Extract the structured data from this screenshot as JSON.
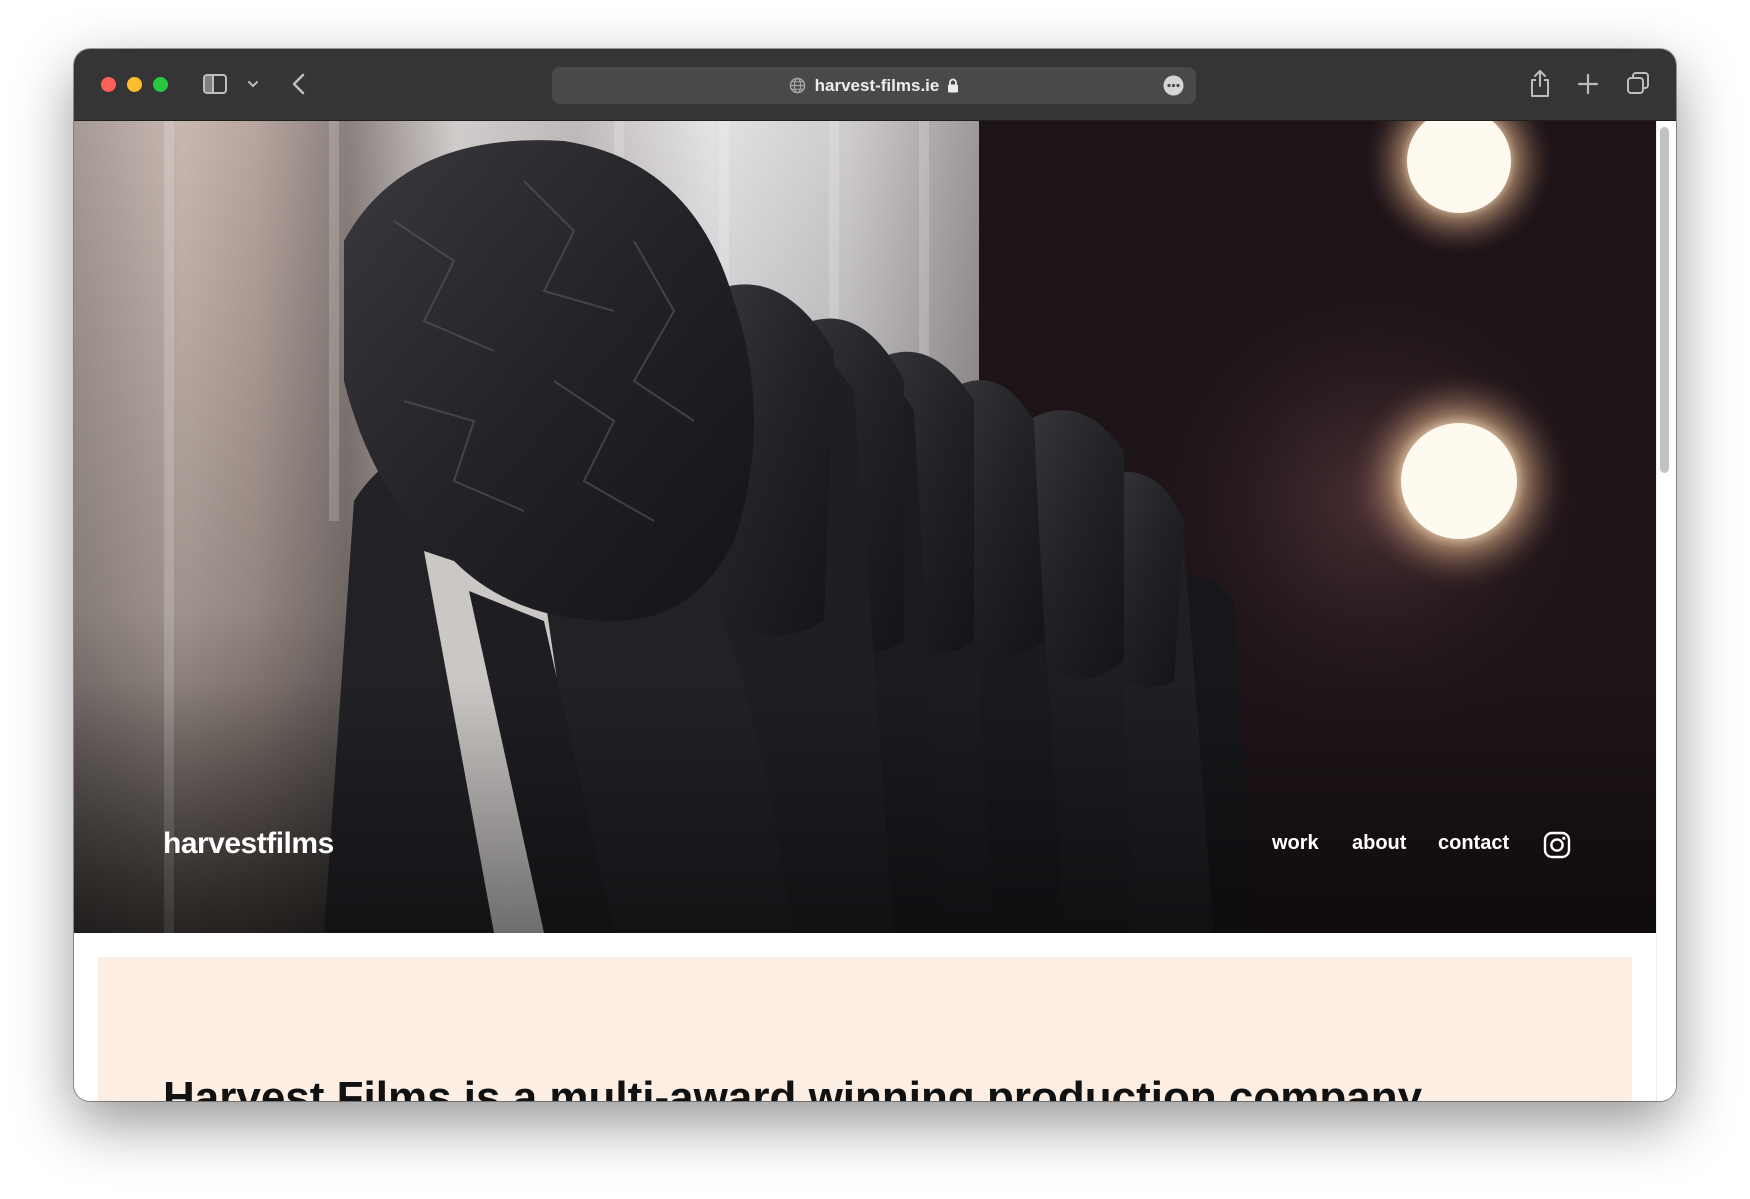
{
  "browser": {
    "url": "harvest-films.ie",
    "icons": {
      "sidebar": "sidebar-icon",
      "chevron": "chevron-down-icon",
      "back": "back-arrow-icon",
      "site": "globe-icon",
      "secure": "lock-icon",
      "more": "more-icon",
      "share": "share-icon",
      "new_tab": "plus-icon",
      "tabs": "tabs-overview-icon"
    },
    "traffic_colors": {
      "close": "#fe5f57",
      "minimize": "#febc2e",
      "maximize": "#28c840"
    }
  },
  "site": {
    "logo": "harvestfilms",
    "nav": [
      {
        "label": "work"
      },
      {
        "label": "about"
      },
      {
        "label": "contact"
      }
    ],
    "social_icon": "instagram-icon",
    "intro_heading": "Harvest Films is a multi-award winning production company",
    "intro_background": "#fdeee3"
  }
}
